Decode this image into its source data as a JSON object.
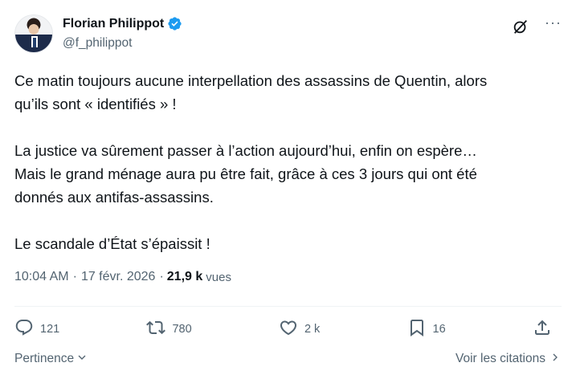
{
  "author": {
    "name": "Florian Philippot",
    "handle": "@f_philippot",
    "verified_color": "#1d9bf0"
  },
  "tweet": {
    "text": "Ce matin toujours aucune interpellation des assassins de Quentin, alors\nqu’ils sont « identifiés » !\n\nLa justice va sûrement passer à l’action aujourd’hui, enfin on espère…\nMais le grand ménage aura pu être fait, grâce à ces 3 jours qui ont été\ndonnés aux antifas-assassins.\n\nLe scandale d’État s’épaissit !",
    "time": "10:04 AM",
    "separator": "·",
    "date": "17 févr. 2026",
    "views_count": "21,9 k",
    "views_label": "vues"
  },
  "actions": {
    "replies": "121",
    "reposts": "780",
    "likes": "2 k",
    "bookmarks": "16"
  },
  "footer": {
    "sort_label": "Pertinence",
    "quotes_label": "Voir les citations"
  },
  "icons": {
    "verified": "verified-badge-icon",
    "grok": "grok-icon",
    "more": "more-icon",
    "reply": "reply-icon",
    "repost": "repost-icon",
    "like": "heart-icon",
    "bookmark": "bookmark-icon",
    "share": "share-icon"
  }
}
